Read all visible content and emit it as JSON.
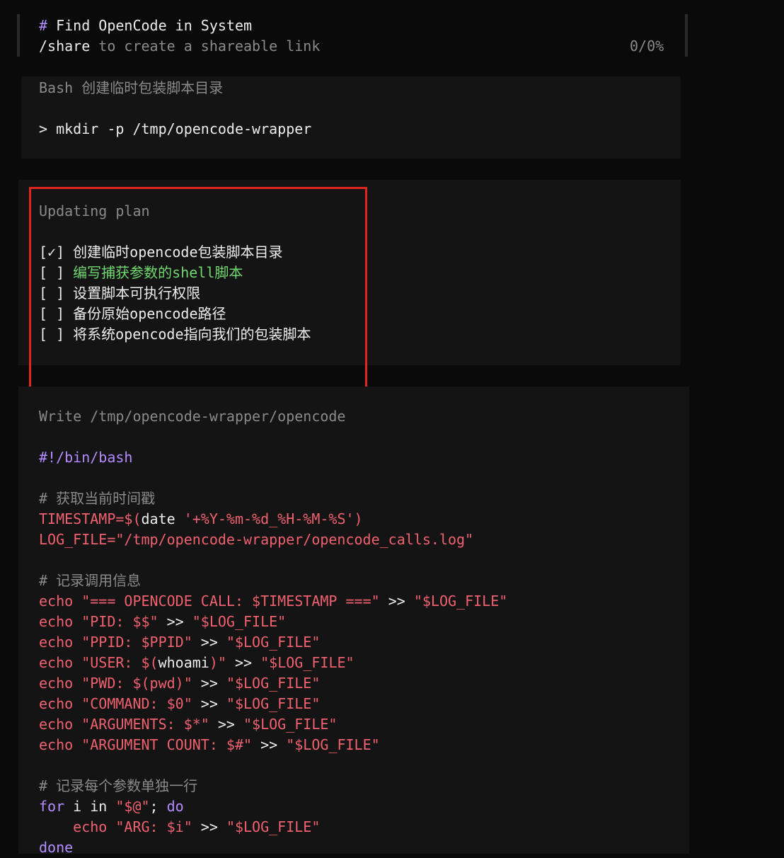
{
  "header": {
    "hash": "#",
    "title": "Find OpenCode in System",
    "share_cmd": "/share",
    "share_text": " to create a shareable link",
    "progress": "0/0%"
  },
  "bash_block": {
    "label": "Bash 创建临时包装脚本目录",
    "command": "> mkdir -p /tmp/opencode-wrapper"
  },
  "plan_block": {
    "label": "Updating plan",
    "items": [
      {
        "box": "[✓]",
        "text": "创建临时opencode包装脚本目录",
        "state": "done"
      },
      {
        "box": "[ ]",
        "text": "编写捕获参数的shell脚本",
        "state": "active"
      },
      {
        "box": "[ ]",
        "text": "设置脚本可执行权限",
        "state": "todo"
      },
      {
        "box": "[ ]",
        "text": "备份原始opencode路径",
        "state": "todo"
      },
      {
        "box": "[ ]",
        "text": "将系统opencode指向我们的包装脚本",
        "state": "todo"
      }
    ]
  },
  "write_block": {
    "label": "Write /tmp/opencode-wrapper/opencode",
    "lines": {
      "shebang": "#!/bin/bash",
      "c1": "# 获取当前时间戳",
      "ts_var": "TIMESTAMP",
      "ts_eq": "=$(",
      "ts_date": "date",
      "ts_fmt": " '+%Y-%m-%d_%H-%M-%S'",
      "ts_close": ")",
      "log_var": "LOG_FILE",
      "log_val": "=\"/tmp/opencode-wrapper/opencode_calls.log\"",
      "c2": "# 记录调用信息",
      "e1_kw": "echo",
      "e1_a": " \"=== OPENCODE CALL: $TIMESTAMP ===\"",
      "e1_b": " >> ",
      "e1_c": "\"$LOG_FILE\"",
      "e2_kw": "echo",
      "e2_a": " \"PID: $$\"",
      "e2_b": " >> ",
      "e2_c": "\"$LOG_FILE\"",
      "e3_kw": "echo",
      "e3_a": " \"PPID: $PPID\"",
      "e3_b": " >> ",
      "e3_c": "\"$LOG_FILE\"",
      "e4_kw": "echo",
      "e4_a": " \"USER: $(",
      "e4_mid": "whoami",
      "e4_a2": ")\"",
      "e4_b": " >> ",
      "e4_c": "\"$LOG_FILE\"",
      "e5_kw": "echo",
      "e5_a": " \"PWD: $(",
      "e5_mid": "pwd",
      "e5_a2": ")\"",
      "e5_b": " >> ",
      "e5_c": "\"$LOG_FILE\"",
      "e6_kw": "echo",
      "e6_a": " \"COMMAND: $0\"",
      "e6_b": " >> ",
      "e6_c": "\"$LOG_FILE\"",
      "e7_kw": "echo",
      "e7_a": " \"ARGUMENTS: $*\"",
      "e7_b": " >> ",
      "e7_c": "\"$LOG_FILE\"",
      "e8_kw": "echo",
      "e8_a": " \"ARGUMENT COUNT: $#\"",
      "e8_b": " >> ",
      "e8_c": "\"$LOG_FILE\"",
      "c3": "# 记录每个参数单独一行",
      "for_kw": "for",
      "for_mid": " i in ",
      "for_str": "\"$@\"",
      "for_semi": "; ",
      "for_do": "do",
      "loop_indent": "    ",
      "loop_kw": "echo",
      "loop_a": " \"ARG: $i\"",
      "loop_b": " >> ",
      "loop_c": "\"$LOG_FILE\"",
      "done_kw": "done"
    }
  },
  "colors": {
    "background": "#0a0a0a",
    "panel": "#141414",
    "accent_red": "#e0261f",
    "keyword": "#f0616f",
    "string": "#f0616f",
    "comment": "#8a8a8a",
    "shebang": "#b58cff",
    "active_item": "#6fd86f"
  }
}
